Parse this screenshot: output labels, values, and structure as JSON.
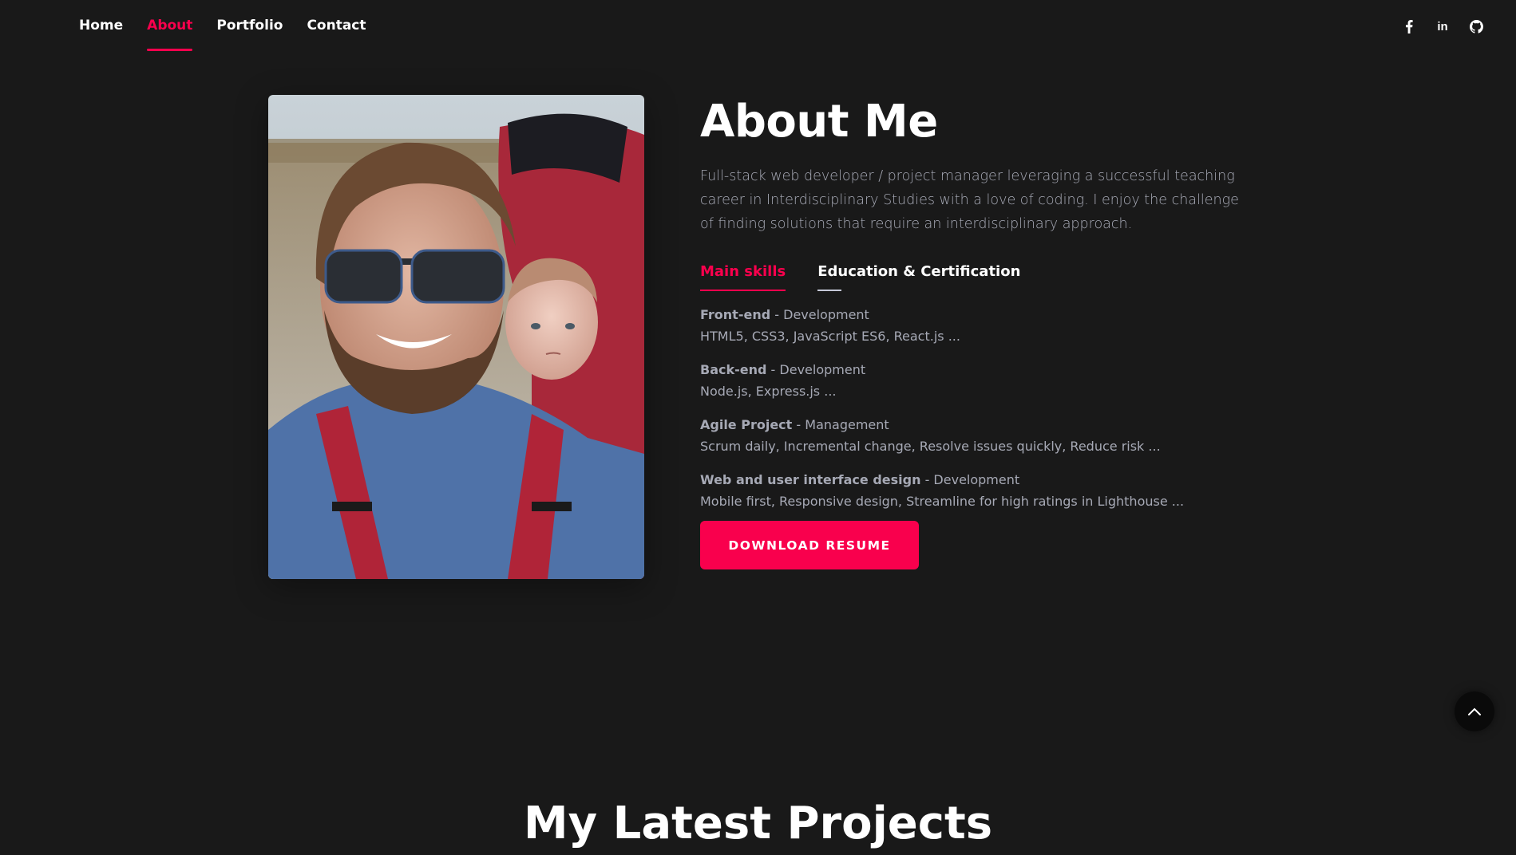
{
  "nav": {
    "items": [
      {
        "label": "Home"
      },
      {
        "label": "About"
      },
      {
        "label": "Portfolio"
      },
      {
        "label": "Contact"
      }
    ],
    "active": "About"
  },
  "social": {
    "icons": [
      "facebook-icon",
      "linkedin-icon",
      "github-icon"
    ],
    "linkedin_text": "in"
  },
  "about": {
    "title": "About Me",
    "description": "Full-stack web developer / project manager leveraging a successful teaching career in Interdisciplinary Studies with a love of coding. I enjoy the challenge of finding solutions that require an interdisciplinary approach.",
    "tabs": [
      {
        "label": "Main skills"
      },
      {
        "label": "Education & Certification"
      }
    ],
    "skills": [
      {
        "name": "Front-end",
        "type": " - Development",
        "detail": "HTML5, CSS3, JavaScript ES6, React.js ..."
      },
      {
        "name": "Back-end",
        "type": " - Development",
        "detail": "Node.js, Express.js ..."
      },
      {
        "name": "Agile Project",
        "type": " - Management",
        "detail": "Scrum daily, Incremental change, Resolve issues quickly, Reduce risk ..."
      },
      {
        "name": "Web and user interface design",
        "type": " - Development",
        "detail": "Mobile first, Responsive design, Streamline for high ratings in Lighthouse ..."
      }
    ],
    "button_label": "DOWNLOAD RESUME"
  },
  "next_section": {
    "title": "My Latest Projects"
  },
  "colors": {
    "background": "#191919",
    "accent": "#f9004d",
    "text": "#ffffff",
    "muted": "#c6c9d8"
  }
}
